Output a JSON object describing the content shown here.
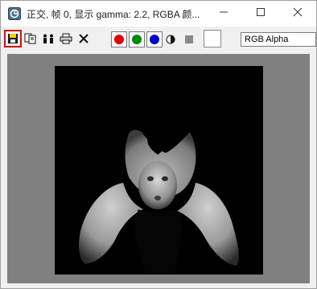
{
  "window": {
    "title": "正交, 帧 0, 显示 gamma: 2.2, RGBA 颜..."
  },
  "titlebar_buttons": {
    "minimize": "—",
    "maximize": "☐",
    "close": "✕"
  },
  "toolbar": {
    "icons": [
      "save-icon",
      "copy-icon",
      "clone-icon",
      "print-icon",
      "clear-icon"
    ],
    "channel_dots": {
      "red": "#e00000",
      "green": "#008a00",
      "blue": "#0000cc"
    },
    "channel_select_value": "RGB Alpha"
  },
  "colors": {
    "viewport_bg": "#808080",
    "render_bg": "#000000",
    "selected_border": "#d01010",
    "color_well": "#ffffff"
  }
}
